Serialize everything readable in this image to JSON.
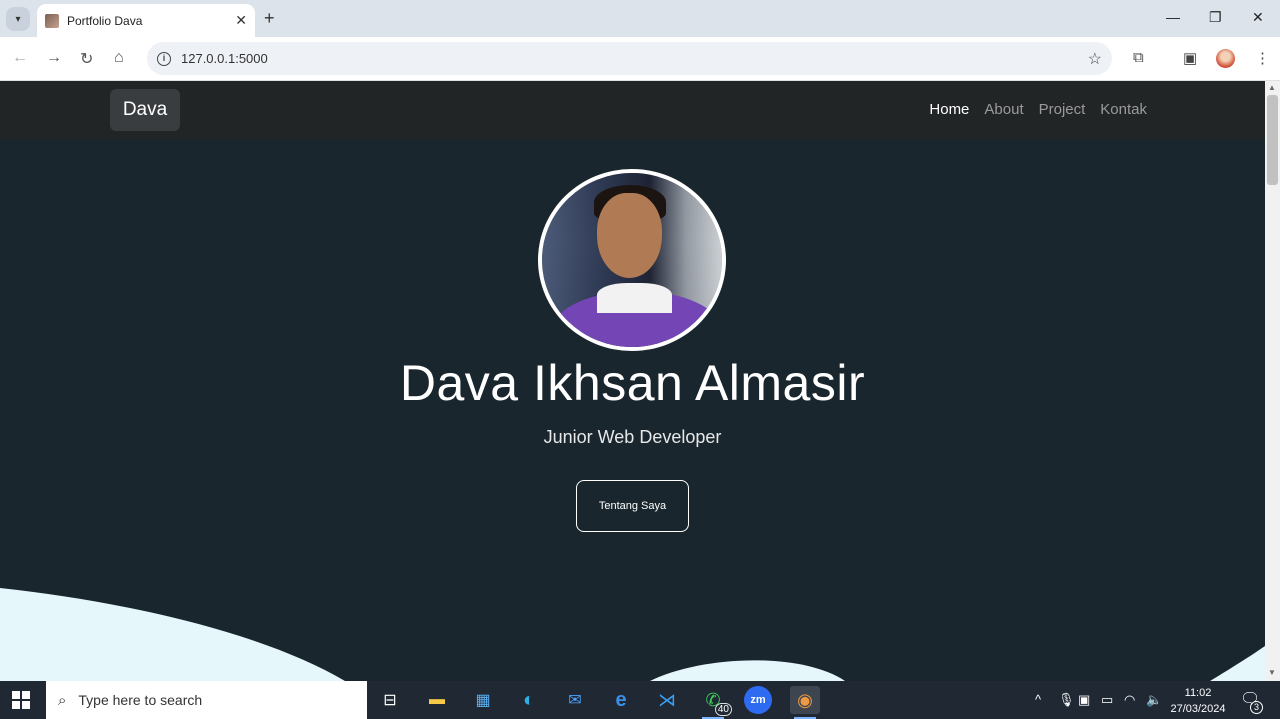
{
  "browser": {
    "tab_title": "Portfolio Dava",
    "url": "127.0.0.1:5000"
  },
  "navbar": {
    "brand": "Dava",
    "links": [
      "Home",
      "About",
      "Project",
      "Kontak"
    ],
    "active": "Home"
  },
  "hero": {
    "name": "Dava Ikhsan Almasir",
    "role": "Junior Web Developer",
    "button_label": "Tentang Saya"
  },
  "taskbar": {
    "search_placeholder": "Type here to search",
    "whatsapp_badge": "40",
    "time": "11:02",
    "date": "27/03/2024",
    "notifications": "3"
  },
  "colors": {
    "page_bg": "#19262d",
    "navbar_bg": "#222526",
    "wave": "#e6f7fb"
  }
}
